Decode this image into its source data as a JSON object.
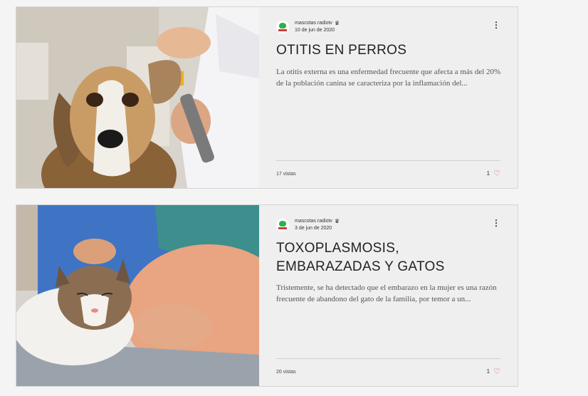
{
  "posts": [
    {
      "author": "mascotas radiotv",
      "date": "10 de jun de 2020",
      "title": "OTITIS EN PERROS",
      "excerpt": "La otitis externa es una enfermedad frecuente que afecta a más del 20% de la población canina  se caracteriza por la  inflamación del...",
      "views": "17 vistas",
      "likes": "1",
      "image_icon": "beagle-vet-photo"
    },
    {
      "author": "mascotas radiotv",
      "date": "3 de jun de 2020",
      "title": "TOXOPLASMOSIS, EMBARAZADAS Y GATOS",
      "excerpt": "Tristemente, se ha detectado que el embarazo en la mujer es una razón frecuente de abandono del gato de la familia, por temor a un...",
      "views": "20 vistas",
      "likes": "1",
      "image_icon": "cat-pregnant-photo"
    }
  ],
  "icons": {
    "more": "⋮",
    "heart": "♡",
    "crown": "♛"
  },
  "colors": {
    "heart": "#d6454b",
    "card_bg": "#efefef",
    "avatar_green": "#2bb24c",
    "avatar_red": "#d43a3a"
  }
}
